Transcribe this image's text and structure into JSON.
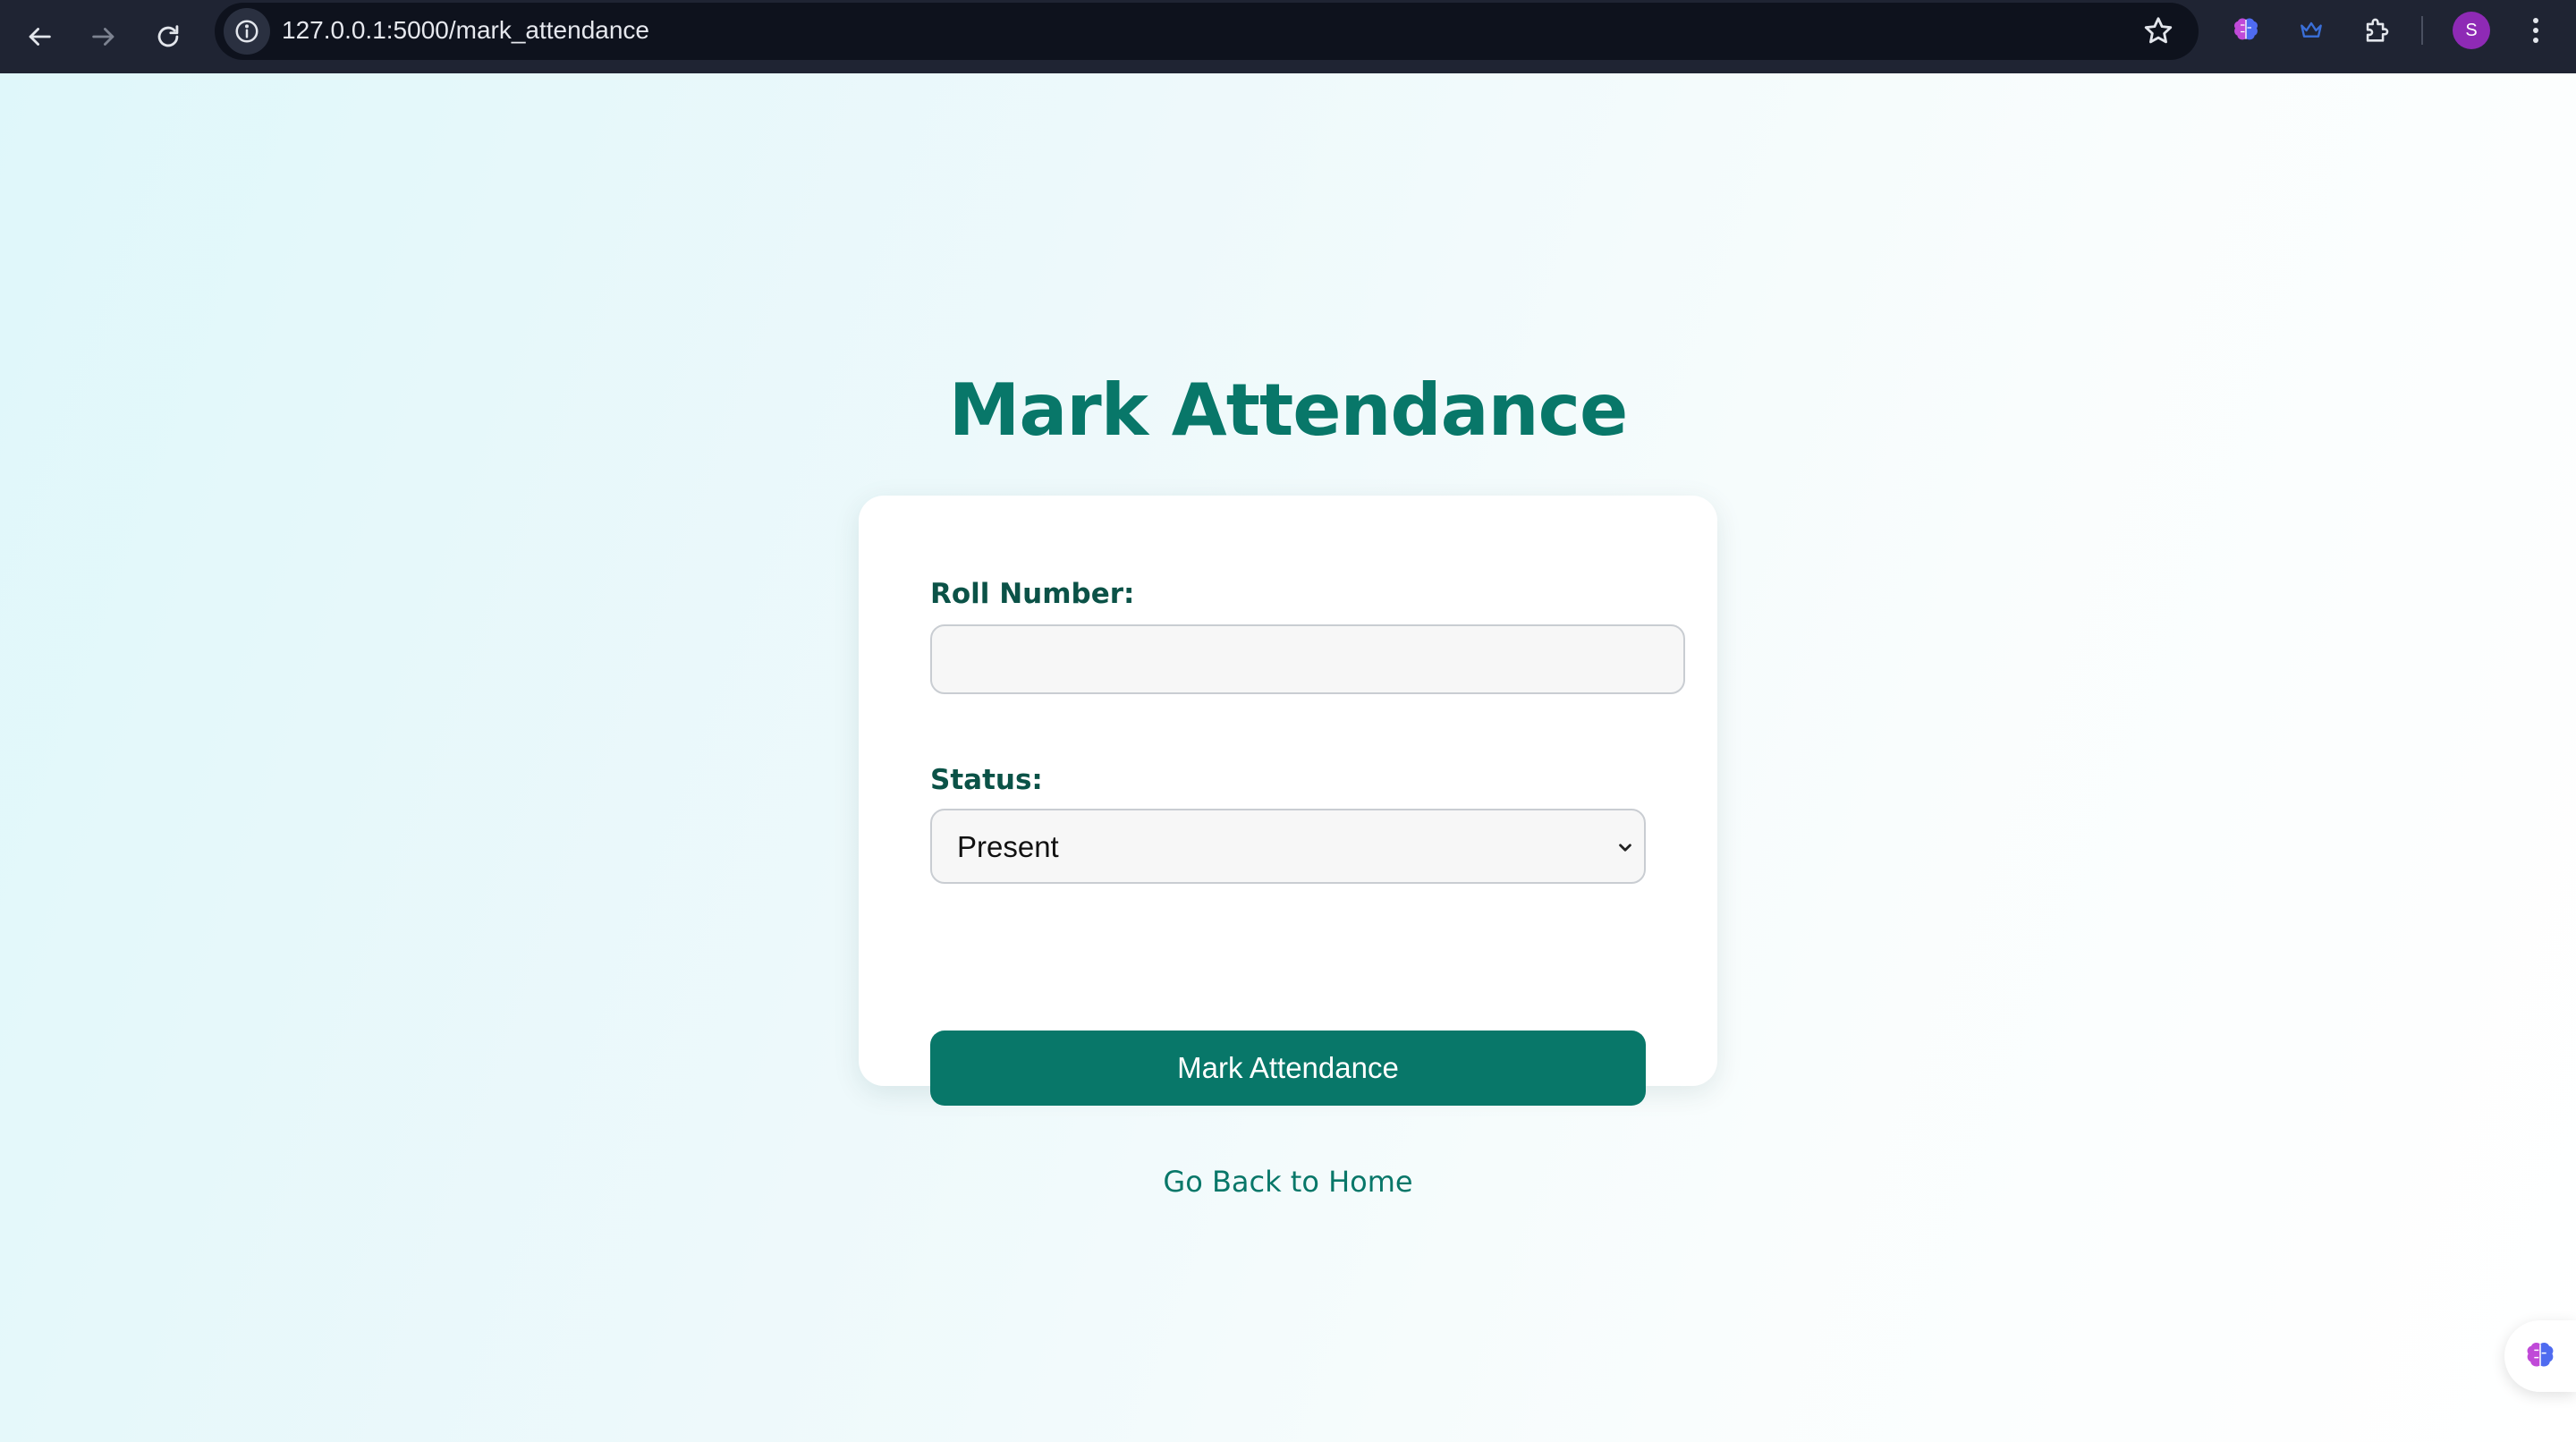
{
  "browser": {
    "url": "127.0.0.1:5000/mark_attendance",
    "profile_initial": "S",
    "icons": {
      "back": "arrow-left-icon",
      "forward": "arrow-right-icon",
      "reload": "reload-icon",
      "site_info": "info-icon",
      "bookmark": "star-icon",
      "extension_1": "brain-icon",
      "extension_2": "crown-icon",
      "extensions": "puzzle-icon",
      "menu": "kebab-menu-icon"
    }
  },
  "page": {
    "title": "Mark Attendance",
    "form": {
      "roll_label": "Roll Number:",
      "roll_value": "",
      "status_label": "Status:",
      "status_selected": "Present",
      "submit_label": "Mark Attendance"
    },
    "home_link": "Go Back to Home"
  },
  "colors": {
    "accent": "#087769",
    "label": "#0b5247",
    "chrome": "#1f2433"
  }
}
